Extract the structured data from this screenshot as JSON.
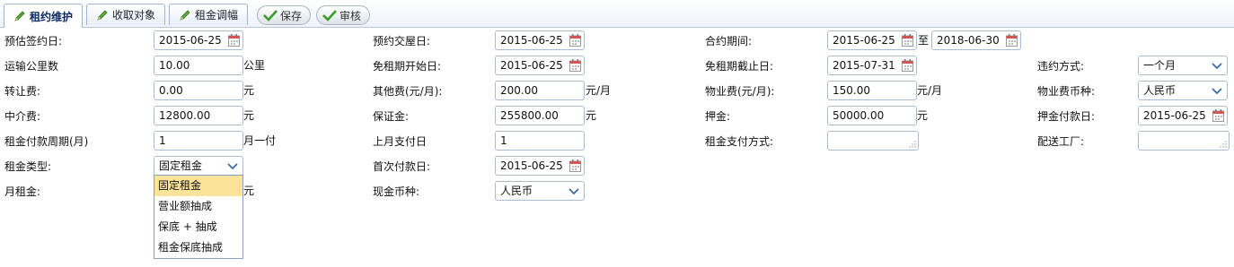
{
  "tabs": [
    {
      "label": "租约维护",
      "active": true
    },
    {
      "label": "收取对象",
      "active": false
    },
    {
      "label": "租金调幅",
      "active": false
    }
  ],
  "actions": {
    "save_label": "保存",
    "audit_label": "审核"
  },
  "form": {
    "est_sign_date": {
      "label": "预估签约日:",
      "value": "2015-06-25"
    },
    "transport_km": {
      "label": "运输公里数",
      "value": "10.00",
      "unit": "公里"
    },
    "transfer_fee": {
      "label": "转让费:",
      "value": "0.00",
      "unit": "元"
    },
    "agency_fee": {
      "label": "中介费:",
      "value": "12800.00",
      "unit": "元"
    },
    "rent_cycle": {
      "label": "租金付款周期(月)",
      "value": "1",
      "unit": "月一付"
    },
    "rent_type": {
      "label": "租金类型:",
      "value": "固定租金",
      "options": [
        "固定租金",
        "营业额抽成",
        "保底 + 抽成",
        "租金保底抽成"
      ]
    },
    "monthly_rent": {
      "label": "月租金:",
      "unit": "元"
    },
    "handover_date": {
      "label": "预约交屋日:",
      "value": "2015-06-25"
    },
    "free_start": {
      "label": "免租期开始日:",
      "value": "2015-06-25"
    },
    "other_fee": {
      "label": "其他费(元/月):",
      "value": "200.00",
      "unit": "元/月"
    },
    "deposit_bond": {
      "label": "保证金:",
      "value": "255800.00",
      "unit": "元"
    },
    "last_month_pay": {
      "label": "上月支付日",
      "value": "1"
    },
    "first_pay_date": {
      "label": "首次付款日:",
      "value": "2015-06-25"
    },
    "cash_currency": {
      "label": "现金币种:",
      "value": "人民币"
    },
    "contract_period": {
      "label": "合约期间:",
      "start": "2015-06-25",
      "sep": "至",
      "end": "2018-06-30"
    },
    "free_end": {
      "label": "免租期截止日:",
      "value": "2015-07-31"
    },
    "property_fee": {
      "label": "物业费(元/月):",
      "value": "150.00",
      "unit": "元/月"
    },
    "deposit": {
      "label": "押金:",
      "value": "50000.00",
      "unit": "元"
    },
    "rent_pay_method": {
      "label": "租金支付方式:",
      "value": ""
    },
    "breach_method": {
      "label": "违约方式:",
      "value": "一个月"
    },
    "property_currency": {
      "label": "物业费币种:",
      "value": "人民币"
    },
    "deposit_pay_date": {
      "label": "押金付款日:",
      "value": "2015-06-25"
    },
    "delivery_factory": {
      "label": "配送工厂:",
      "value": ""
    }
  },
  "colors": {
    "tab_text_active": "#0a2a66",
    "highlight": "#fbe39a",
    "input_border": "#a9bbd4"
  },
  "icons": {
    "tab": "pencil-icon",
    "button": "check-icon",
    "date": "calendar-icon",
    "select": "chevron-down-icon",
    "textarea": "resize-grip-icon"
  }
}
